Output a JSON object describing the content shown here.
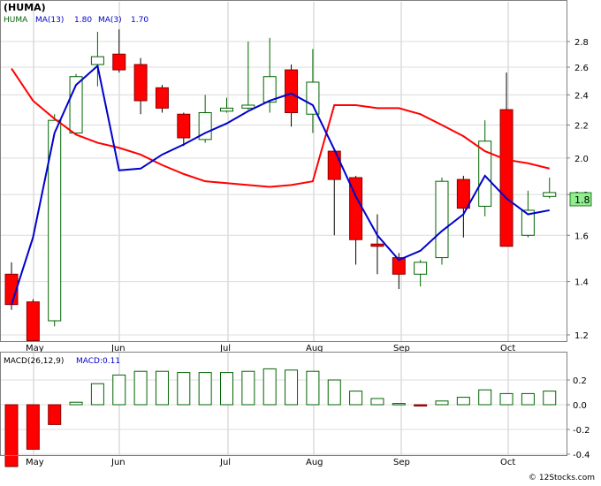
{
  "title": "(HUMA)",
  "legend": {
    "ticker": "HUMA",
    "ma13_label": "MA(13)",
    "ma13_value": "1.80",
    "ma3_label": "MA(3)",
    "ma3_value": "1.70"
  },
  "macd_legend": {
    "label": "MACD(26,12,9)",
    "value_label": "MACD:0.11"
  },
  "last_price_tag": "1.8",
  "watermark": "© 12Stocks.com",
  "colors": {
    "up_fill": "#ffffff",
    "up_stroke": "#006400",
    "down_fill": "#ff0000",
    "ma13": "#ff0000",
    "ma3": "#0000cc",
    "macd_bar": "#006400",
    "tag_bg": "#90ee90"
  },
  "chart_data": {
    "type": "candlestick",
    "y_scale": "log",
    "x_labels": [
      "May",
      "Jun",
      "Jul",
      "Aug",
      "Sep",
      "Oct"
    ],
    "price_ticks": [
      "1.2",
      "1.4",
      "1.6",
      "1.8",
      "2.0",
      "2.2",
      "2.4",
      "2.6",
      "2.8"
    ],
    "macd_ticks": [
      "0.2",
      "0.0",
      "-0.2",
      "-0.4"
    ],
    "candles": [
      {
        "open": 1.43,
        "high": 1.48,
        "low": 1.29,
        "close": 1.31
      },
      {
        "open": 1.32,
        "high": 1.33,
        "low": 1.19,
        "close": 1.18
      },
      {
        "open": 1.25,
        "high": 2.27,
        "low": 1.23,
        "close": 2.23
      },
      {
        "open": 2.15,
        "high": 2.55,
        "low": 2.14,
        "close": 2.53
      },
      {
        "open": 2.62,
        "high": 2.88,
        "low": 2.46,
        "close": 2.68
      },
      {
        "open": 2.7,
        "high": 2.9,
        "low": 2.56,
        "close": 2.58
      },
      {
        "open": 2.62,
        "high": 2.67,
        "low": 2.27,
        "close": 2.36
      },
      {
        "open": 2.45,
        "high": 2.47,
        "low": 2.28,
        "close": 2.31
      },
      {
        "open": 2.27,
        "high": 2.28,
        "low": 2.07,
        "close": 2.12
      },
      {
        "open": 2.11,
        "high": 2.4,
        "low": 2.09,
        "close": 2.28
      },
      {
        "open": 2.29,
        "high": 2.38,
        "low": 2.28,
        "close": 2.31
      },
      {
        "open": 2.31,
        "high": 2.8,
        "low": 2.3,
        "close": 2.33
      },
      {
        "open": 2.35,
        "high": 2.83,
        "low": 2.28,
        "close": 2.53
      },
      {
        "open": 2.58,
        "high": 2.62,
        "low": 2.19,
        "close": 2.28
      },
      {
        "open": 2.27,
        "high": 2.74,
        "low": 2.15,
        "close": 2.49
      },
      {
        "open": 2.04,
        "high": 2.05,
        "low": 1.6,
        "close": 1.88
      },
      {
        "open": 1.89,
        "high": 1.9,
        "low": 1.47,
        "close": 1.58
      },
      {
        "open": 1.56,
        "high": 1.7,
        "low": 1.43,
        "close": 1.55
      },
      {
        "open": 1.5,
        "high": 1.52,
        "low": 1.37,
        "close": 1.43
      },
      {
        "open": 1.43,
        "high": 1.49,
        "low": 1.38,
        "close": 1.48
      },
      {
        "open": 1.5,
        "high": 1.89,
        "low": 1.47,
        "close": 1.87
      },
      {
        "open": 1.88,
        "high": 1.9,
        "low": 1.59,
        "close": 1.73
      },
      {
        "open": 1.74,
        "high": 2.23,
        "low": 1.69,
        "close": 2.1
      },
      {
        "open": 2.3,
        "high": 2.56,
        "low": 1.55,
        "close": 1.55
      },
      {
        "open": 1.6,
        "high": 1.82,
        "low": 1.59,
        "close": 1.72
      },
      {
        "open": 1.79,
        "high": 1.89,
        "low": 1.78,
        "close": 1.81
      }
    ],
    "ma13": [
      2.59,
      2.36,
      2.24,
      2.14,
      2.09,
      2.06,
      2.02,
      1.96,
      1.91,
      1.87,
      1.86,
      1.85,
      1.84,
      1.85,
      1.87,
      2.33,
      2.33,
      2.31,
      2.31,
      2.27,
      2.2,
      2.13,
      2.04,
      1.99,
      1.97,
      1.94,
      1.92,
      1.84,
      1.78,
      1.69
    ],
    "ma3_points": [
      {
        "i": 1,
        "v": 1.31
      },
      {
        "i": 2,
        "v": 1.59
      },
      {
        "i": 3,
        "v": 2.15
      },
      {
        "i": 4,
        "v": 2.47
      },
      {
        "i": 5,
        "v": 2.61
      },
      {
        "i": 7,
        "v": 2.29
      },
      {
        "i": 8,
        "v": 2.27
      },
      {
        "i": 9,
        "v": 2.28
      },
      {
        "i": 10,
        "v": 2.3
      },
      {
        "i": 11,
        "v": 2.34
      },
      {
        "i": 12,
        "v": 2.33
      },
      {
        "i": 13,
        "v": 2.35
      },
      {
        "i": 14,
        "v": 2.36
      },
      {
        "i": 16,
        "v": 2.32
      },
      {
        "i": 19,
        "v": 1.47
      },
      {
        "i": 20,
        "v": 1.5
      },
      {
        "i": 22,
        "v": 1.82
      },
      {
        "i": 23,
        "v": 1.91
      }
    ],
    "ma3_fallback": [
      1.31,
      1.59,
      2.15,
      2.47,
      2.61,
      1.93,
      1.94,
      2.02,
      2.08,
      2.15,
      2.21,
      2.29,
      2.36,
      2.41,
      2.33,
      2.05,
      1.79,
      1.6,
      1.49,
      1.53,
      1.62,
      1.7,
      1.9,
      1.78,
      1.7,
      1.72
    ],
    "macd": [
      -0.5,
      -0.36,
      -0.16,
      0.02,
      0.17,
      0.24,
      0.27,
      0.27,
      0.26,
      0.26,
      0.26,
      0.27,
      0.29,
      0.28,
      0.27,
      0.2,
      0.11,
      0.05,
      0.01,
      -0.01,
      0.03,
      0.06,
      0.12,
      0.09,
      0.09,
      0.11
    ]
  }
}
